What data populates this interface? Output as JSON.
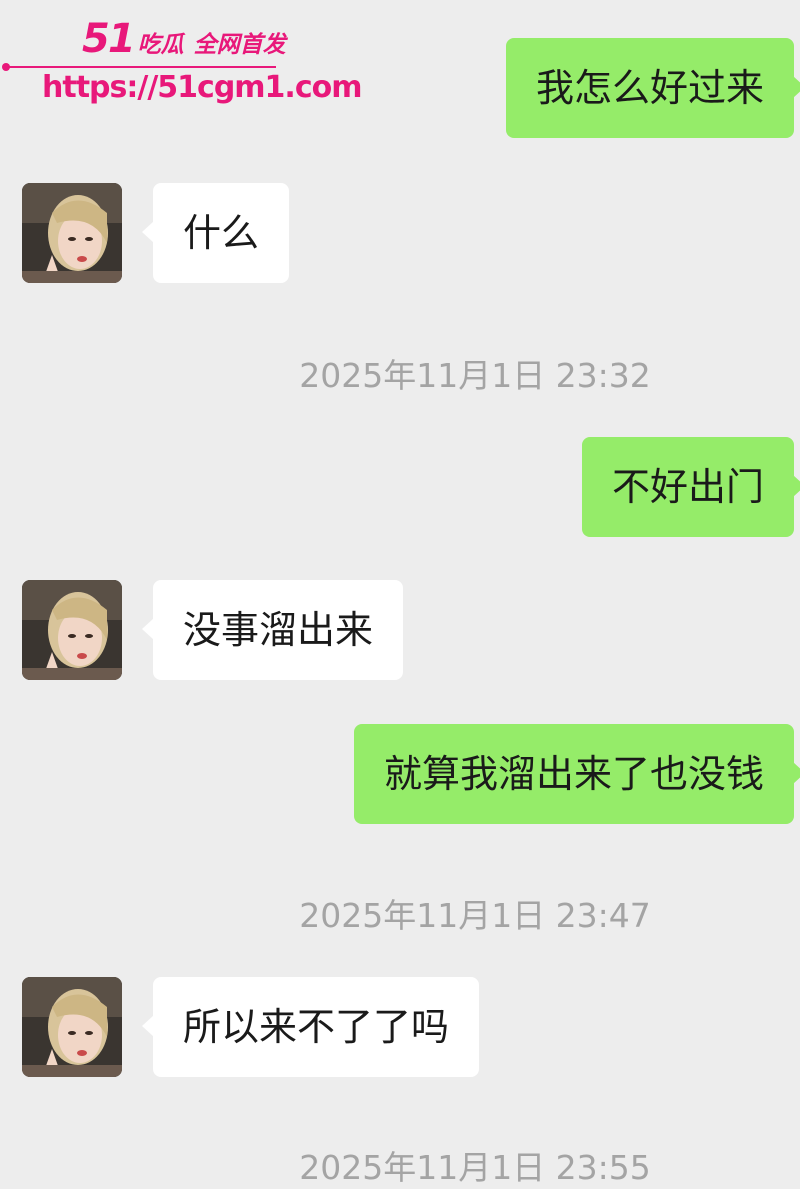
{
  "watermark": {
    "brand_num": "51",
    "brand_name": "吃瓜",
    "brand_tag": "全网首发",
    "url": "https://51cgm1.com"
  },
  "chat": {
    "messages": [
      {
        "side": "out",
        "text": "我怎么好过来"
      },
      {
        "side": "in",
        "text": "什么",
        "avatar": "contact-avatar"
      },
      {
        "type": "time",
        "text": "2025年11月1日 23:32"
      },
      {
        "side": "out",
        "text": "不好出门"
      },
      {
        "side": "in",
        "text": "没事溜出来",
        "avatar": "contact-avatar"
      },
      {
        "side": "out",
        "text": "就算我溜出来了也没钱"
      },
      {
        "type": "time",
        "text": "2025年11月1日 23:47"
      },
      {
        "side": "in",
        "text": "所以来不了了吗",
        "avatar": "contact-avatar"
      },
      {
        "type": "time",
        "text": "2025年11月1日 23:55"
      }
    ]
  },
  "colors": {
    "outgoing_bubble": "#95ec69",
    "incoming_bubble": "#ffffff",
    "background": "#ededed",
    "timestamp_text": "#a4a4a4",
    "watermark": "#e8187a"
  }
}
